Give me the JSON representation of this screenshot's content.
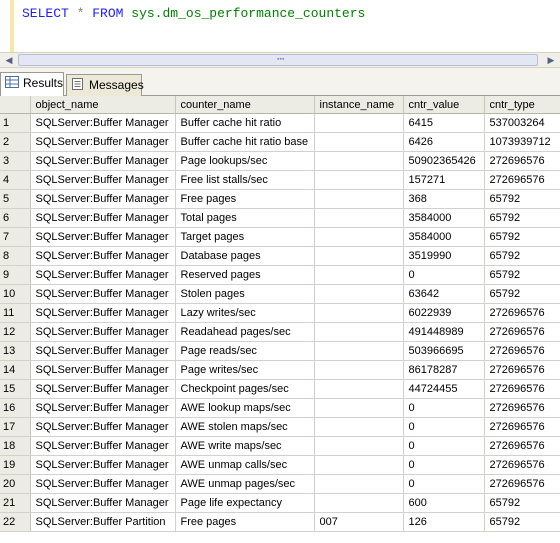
{
  "editor": {
    "query_parts": {
      "select": "SELECT",
      "star": "*",
      "from": "FROM",
      "table": "sys.dm_os_performance_counters"
    }
  },
  "tabs": [
    {
      "label": "Results",
      "icon": "grid-icon",
      "active": true
    },
    {
      "label": "Messages",
      "icon": "messages-icon",
      "active": false
    }
  ],
  "grid": {
    "columns": [
      "object_name",
      "counter_name",
      "instance_name",
      "cntr_value",
      "cntr_type"
    ],
    "rows": [
      [
        "1",
        "SQLServer:Buffer Manager",
        "Buffer cache hit ratio",
        "",
        "6415",
        "537003264"
      ],
      [
        "2",
        "SQLServer:Buffer Manager",
        "Buffer cache hit ratio base",
        "",
        "6426",
        "1073939712"
      ],
      [
        "3",
        "SQLServer:Buffer Manager",
        "Page lookups/sec",
        "",
        "50902365426",
        "272696576"
      ],
      [
        "4",
        "SQLServer:Buffer Manager",
        "Free list stalls/sec",
        "",
        "157271",
        "272696576"
      ],
      [
        "5",
        "SQLServer:Buffer Manager",
        "Free pages",
        "",
        "368",
        "65792"
      ],
      [
        "6",
        "SQLServer:Buffer Manager",
        "Total pages",
        "",
        "3584000",
        "65792"
      ],
      [
        "7",
        "SQLServer:Buffer Manager",
        "Target pages",
        "",
        "3584000",
        "65792"
      ],
      [
        "8",
        "SQLServer:Buffer Manager",
        "Database pages",
        "",
        "3519990",
        "65792"
      ],
      [
        "9",
        "SQLServer:Buffer Manager",
        "Reserved pages",
        "",
        "0",
        "65792"
      ],
      [
        "10",
        "SQLServer:Buffer Manager",
        "Stolen pages",
        "",
        "63642",
        "65792"
      ],
      [
        "11",
        "SQLServer:Buffer Manager",
        "Lazy writes/sec",
        "",
        "6022939",
        "272696576"
      ],
      [
        "12",
        "SQLServer:Buffer Manager",
        "Readahead pages/sec",
        "",
        "491448989",
        "272696576"
      ],
      [
        "13",
        "SQLServer:Buffer Manager",
        "Page reads/sec",
        "",
        "503966695",
        "272696576"
      ],
      [
        "14",
        "SQLServer:Buffer Manager",
        "Page writes/sec",
        "",
        "86178287",
        "272696576"
      ],
      [
        "15",
        "SQLServer:Buffer Manager",
        "Checkpoint pages/sec",
        "",
        "44724455",
        "272696576"
      ],
      [
        "16",
        "SQLServer:Buffer Manager",
        "AWE lookup maps/sec",
        "",
        "0",
        "272696576"
      ],
      [
        "17",
        "SQLServer:Buffer Manager",
        "AWE stolen maps/sec",
        "",
        "0",
        "272696576"
      ],
      [
        "18",
        "SQLServer:Buffer Manager",
        "AWE write maps/sec",
        "",
        "0",
        "272696576"
      ],
      [
        "19",
        "SQLServer:Buffer Manager",
        "AWE unmap calls/sec",
        "",
        "0",
        "272696576"
      ],
      [
        "20",
        "SQLServer:Buffer Manager",
        "AWE unmap pages/sec",
        "",
        "0",
        "272696576"
      ],
      [
        "21",
        "SQLServer:Buffer Manager",
        "Page life expectancy",
        "",
        "600",
        "65792"
      ],
      [
        "22",
        "SQLServer:Buffer Partition",
        "Free pages",
        "007",
        "126",
        "65792"
      ]
    ]
  },
  "colors": {
    "keyword": "#1d1dff",
    "identifier": "#008000",
    "operator": "#808080",
    "header_bg": "#ecebe4",
    "grid_line": "#d4d2c8"
  }
}
